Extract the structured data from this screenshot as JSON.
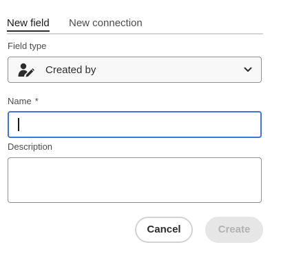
{
  "tabs": [
    {
      "label": "New field",
      "selected": true
    },
    {
      "label": "New connection",
      "selected": false
    }
  ],
  "field_type": {
    "label": "Field type",
    "value": "Created by",
    "icon": "user-edit-icon"
  },
  "name": {
    "label": "Name",
    "required_marker": "*",
    "value": ""
  },
  "description": {
    "label": "Description",
    "value": ""
  },
  "buttons": {
    "cancel": "Cancel",
    "create": "Create"
  },
  "colors": {
    "focus_border": "#3f74cf",
    "text": "#2c2c2c",
    "disabled_bg": "#e6e6e6",
    "disabled_text": "#b2b2b2"
  }
}
